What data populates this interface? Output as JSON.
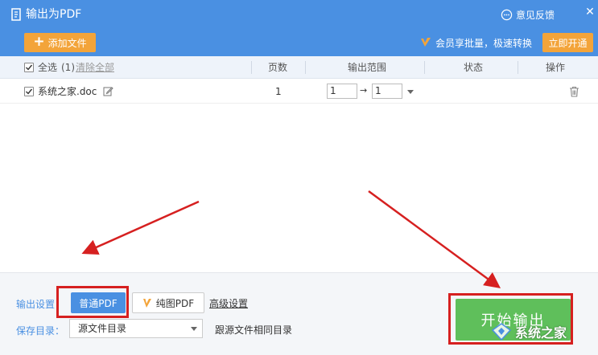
{
  "window": {
    "title": "输出为PDF",
    "feedback_label": "意见反馈",
    "close_glyph": "✕"
  },
  "toolbar": {
    "add_file_label": "添加文件",
    "add_file_plus": "+",
    "vip_promo": "会员享批量，极速转换",
    "open_now_label": "立即开通"
  },
  "table": {
    "select_all_label": "全选",
    "select_all_count": "(1)",
    "clear_all_label": "清除全部",
    "columns": {
      "pages": "页数",
      "range": "输出范围",
      "status": "状态",
      "action": "操作"
    },
    "rows": [
      {
        "filename": "系统之家.doc",
        "pages": "1",
        "range_from": "1",
        "range_to": "1",
        "range_arrow": "→",
        "status": "",
        "checked": true
      }
    ]
  },
  "bottom": {
    "output_settings_label": "输出设置：",
    "normal_pdf_label": "普通PDF",
    "image_pdf_label": "纯图PDF",
    "advanced_label": "高级设置",
    "save_dir_label": "保存目录：",
    "save_dir_value": "源文件目录",
    "same_dir_label": "跟源文件相同目录",
    "start_label": "开始输出"
  },
  "watermark": {
    "text": "系统之家"
  },
  "colors": {
    "header_blue": "#4a90e2",
    "orange": "#f3a43a",
    "green": "#5fbf5b",
    "annotation_red": "#d62020"
  },
  "icons": [
    "pdf-title-icon",
    "feedback-icon",
    "close-icon",
    "plus-icon",
    "vip-icon",
    "checkbox-icon",
    "edit-icon",
    "dropdown-arrow-icon",
    "trash-icon",
    "vip-small-icon",
    "watermark-logo-icon"
  ]
}
